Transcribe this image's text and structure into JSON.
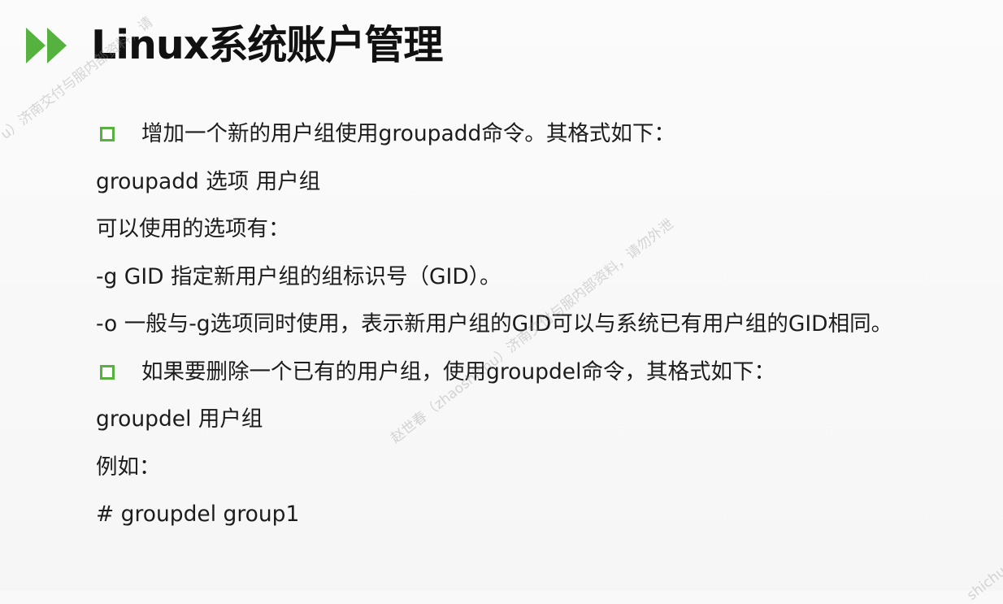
{
  "slide": {
    "title": "Linux系统账户管理",
    "accent_color": "#56b23f",
    "lines": [
      {
        "bullet": true,
        "text": "增加一个新的用户组使用groupadd命令。其格式如下："
      },
      {
        "bullet": false,
        "text": "groupadd 选项 用户组"
      },
      {
        "bullet": false,
        "text": "可以使用的选项有："
      },
      {
        "bullet": false,
        "text": "-g GID 指定新用户组的组标识号（GID）。"
      },
      {
        "bullet": false,
        "text": "-o 一般与-g选项同时使用，表示新用户组的GID可以与系统已有用户组的GID相同。"
      },
      {
        "bullet": true,
        "text": "如果要删除一个已有的用户组，使用groupdel命令，其格式如下："
      },
      {
        "bullet": false,
        "text": "groupdel 用户组"
      },
      {
        "bullet": false,
        "text": "例如："
      },
      {
        "bullet": false,
        "text": "# groupdel group1"
      }
    ]
  },
  "watermarks": [
    "u）济南交付与服内部资料，请",
    "赵世春（zhaoshichu）济南交付与服内部资料，请勿外泄",
    "shichu"
  ]
}
